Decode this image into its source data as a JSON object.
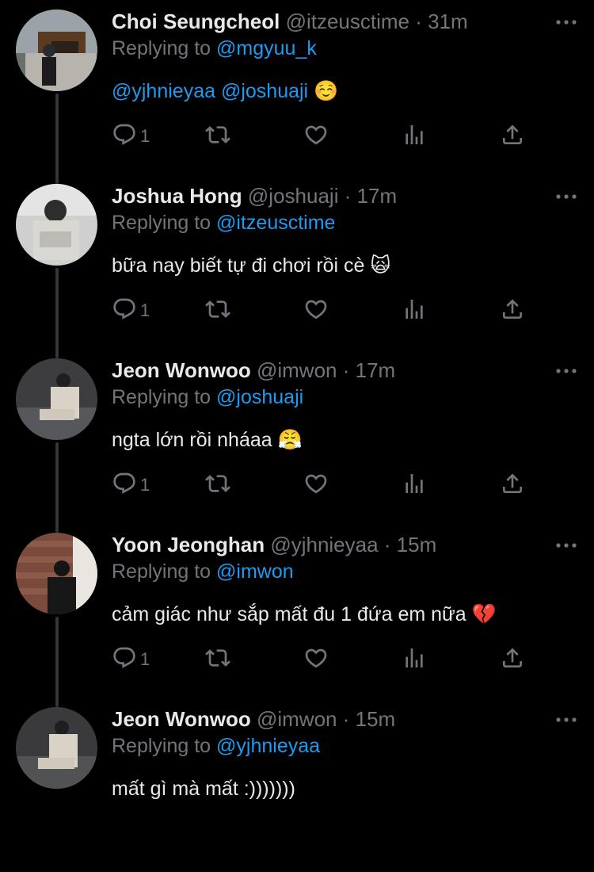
{
  "replying_prefix": "Replying to ",
  "colors": {
    "background": "#000000",
    "text": "#e7e9ea",
    "muted": "#71767b",
    "link": "#1d9bf0",
    "thread_line": "#333639"
  },
  "icons": [
    "reply-icon",
    "retweet-icon",
    "like-icon",
    "views-icon",
    "share-icon",
    "more-icon"
  ],
  "tweets": [
    {
      "name": "Choi Seungcheol",
      "handle": "@itzeusctime",
      "time": "31m",
      "reply_to": "@mgyuu_k",
      "mentions": "@yjhnieyaa @joshuaji",
      "text": "",
      "emoji": "☺️",
      "reply_count": "1"
    },
    {
      "name": "Joshua Hong",
      "handle": "@joshuaji",
      "time": "17m",
      "reply_to": "@itzeusctime",
      "mentions": "",
      "text": "bữa nay biết tự đi chơi rồi cè ",
      "emoji": "🙀",
      "reply_count": "1"
    },
    {
      "name": "Jeon Wonwoo",
      "handle": "@imwon",
      "time": "17m",
      "reply_to": "@joshuaji",
      "mentions": "",
      "text": "ngta lớn rồi nháaa ",
      "emoji": "😤",
      "reply_count": "1"
    },
    {
      "name": "Yoon Jeonghan",
      "handle": "@yjhnieyaa",
      "time": "15m",
      "reply_to": "@imwon",
      "mentions": "",
      "text": "cảm giác như sắp mất đu 1 đứa em nữa ",
      "emoji": "💔",
      "reply_count": "1"
    },
    {
      "name": "Jeon Wonwoo",
      "handle": "@imwon",
      "time": "15m",
      "reply_to": "@yjhnieyaa",
      "mentions": "",
      "text": "mất gì mà mất :)))))))",
      "emoji": "",
      "reply_count": ""
    }
  ]
}
